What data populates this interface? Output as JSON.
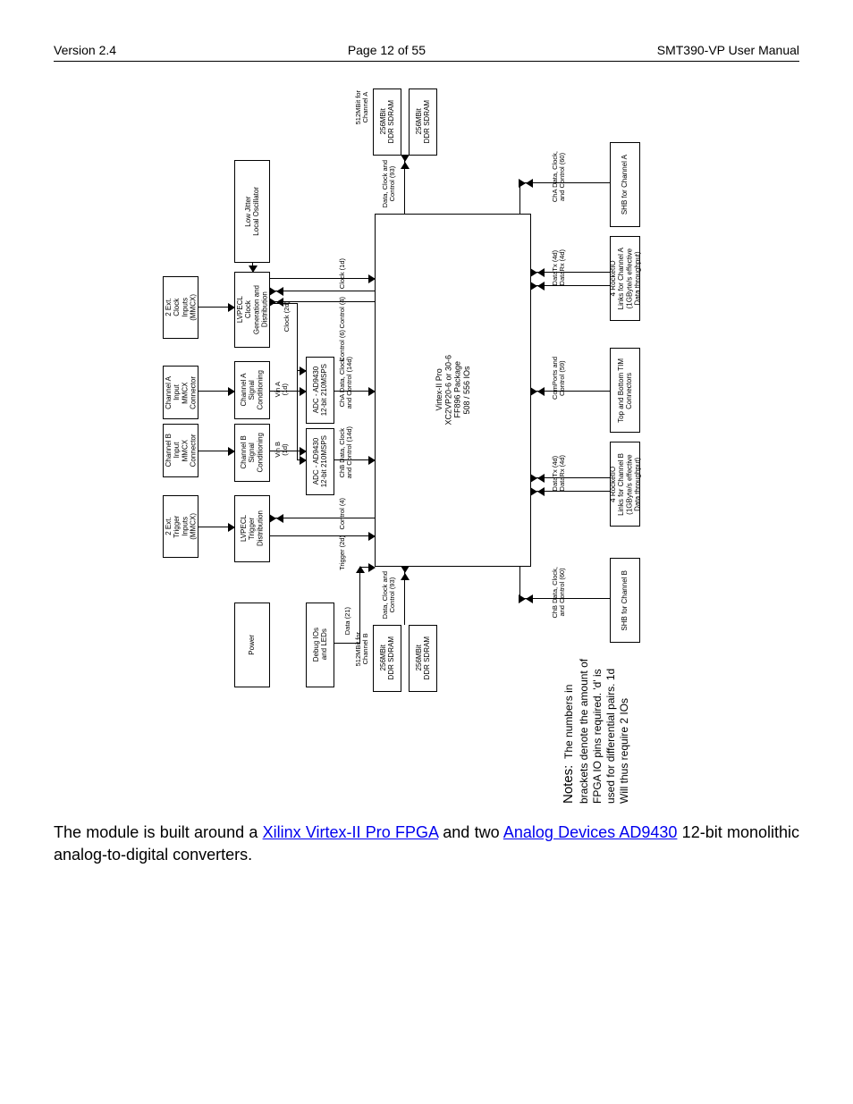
{
  "header": {
    "left": "Version 2.4",
    "center": "Page 12 of 55",
    "right": "SMT390-VP User Manual"
  },
  "diagram": {
    "col1": {
      "ext_clk": "2 Ext.\nClock\nInputs\n(MMCX)",
      "chA_in": "Channel A\nInput\nMMCX\nConnector",
      "chB_in": "Channel B\nInput\nMMCX\nConnector",
      "ext_trig": "2 Ext.\nTrigger\nInputs\n(MMCX)"
    },
    "col2": {
      "osc": "Low Jitter\nLocal Oscillator",
      "clkgen": "LVPECL\nClock\nGeneration and\nDistribution",
      "sigA": "Channel A\nSignal\nConditioning",
      "sigB": "Channel B\nSignal\nConditioning",
      "trig": "LVPECL\nTrigger\nDistribution",
      "power": "Power"
    },
    "col3": {
      "adcA": "ADC - AD9430\n12-bit 210MSPS",
      "adcB": "ADC - AD9430\n12-bit 210MSPS",
      "debug": "Debug IOs\nand LEDs"
    },
    "fpga": "Virtex-II Pro\nXC2VP20-6 or 30-6\nFF896 Package\n508 / 556 IOs",
    "sdram": {
      "upA": "256MBit\nDDR SDRAM",
      "upB": "256MBit\nDDR SDRAM",
      "dnA": "256MBit\nDDR SDRAM",
      "dnB": "256MBit\nDDR SDRAM",
      "upLabel": "512MBit for\nChannel A",
      "dnLabel": "512MBit for\nChannel B"
    },
    "right": {
      "shbA": "SHB for Channel A",
      "rioA": "4 RocketIO\nLinks for Channel A\n(1GByte/s effective\nData throughput)",
      "tim": "Top and Bottom TIM\nConnectors",
      "rioB": "4 RocketIO\nLinks for Channel B\n(1GByte/s effective\nData throughput)",
      "shbB": "SHB for Channel B"
    },
    "labels": {
      "vinA": "Vin A\n(1d)",
      "vinB": "Vin B\n(1d)",
      "clk2d": "Clock (2d)",
      "clk1d": "Clock (1d)",
      "ctl4": "Control (4)",
      "ctl6": "Control (6)",
      "chaDC": "ChA Data, Clock\nand Control (14d)",
      "chbDC": "ChB Data, Clock\nand Control (14d)",
      "ctl4t": "Control (4)",
      "trg2d": "Trigger (2d)",
      "data21": "Data (21)",
      "dcc93t": "Data, Clock and\nControl (93)",
      "dcc93b": "Data, Clock and\nControl (93)",
      "shbAw": "ChA Data, Clock,\nand Control (60)",
      "rioAw": "DataTx (4d)\nDataRx (4d)",
      "timw": "ComPorts and\nControl (59)",
      "rioBw": "DataTx (4d)\nDataRx (4d)",
      "shbBw": "ChB Data, Clock,\nand Control (60)"
    },
    "notes_lead": "Notes:",
    "notes_body": "The numbers in brackets denote\nthe amount of FPGA IO pins\nrequired. 'd' is used for differential\npairs. 1d Will thus require 2 IOs"
  },
  "body": {
    "pre": "The module is built around a ",
    "link1": "Xilinx Virtex-II Pro FPGA",
    "mid": " and two ",
    "link2": "Analog Devices AD9430",
    "post": " 12-bit monolithic analog-to-digital converters."
  }
}
